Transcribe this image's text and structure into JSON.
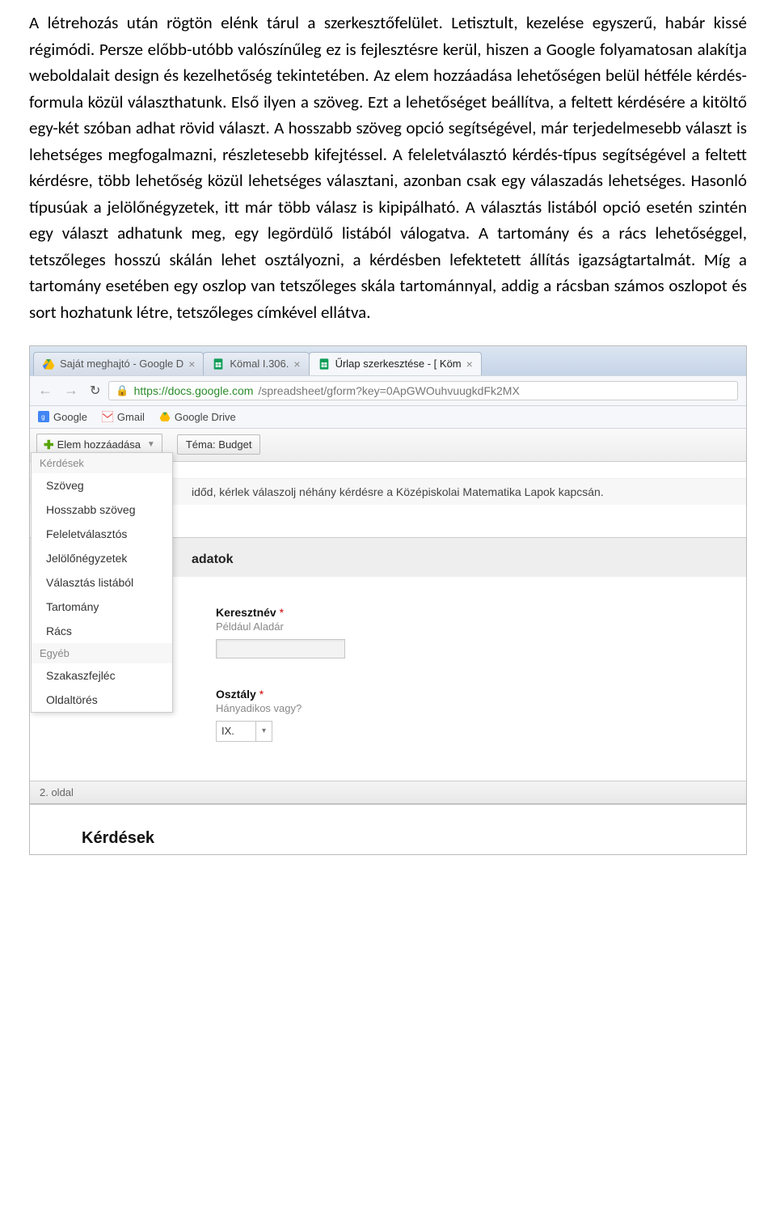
{
  "doc": {
    "paragraph": "A létrehozás után rögtön elénk tárul a szerkesztőfelület. Letisztult, kezelése egyszerű, habár kissé régimódi. Persze előbb-utóbb valószínűleg ez is fejlesztésre kerül, hiszen a Google folyamatosan alakítja weboldalait design és kezelhetőség tekintetében. Az elem hozzáadása lehetőségen belül hétféle kérdés-formula közül választhatunk. Első ilyen a szöveg. Ezt a lehetőséget beállítva, a feltett kérdésére a kitöltő egy-két szóban adhat rövid választ. A hosszabb szöveg opció segítségével, már terjedelmesebb választ is lehetséges megfogalmazni, részletesebb kifejtéssel. A feleletválasztó kérdés-típus segítségével a feltett kérdésre, több lehetőség közül lehetséges választani, azonban csak egy válaszadás lehetséges. Hasonló típusúak a jelölőnégyzetek, itt már több válasz is kipipálható. A választás listából opció esetén szintén egy választ adhatunk meg, egy legördülő listából válogatva. A tartomány és a rács lehetőséggel, tetszőleges hosszú skálán lehet osztályozni, a kérdésben lefektetett állítás igazságtartalmát. Míg a tartomány esetében egy oszlop van tetszőleges skála tartománnyal, addig a rácsban számos oszlopot és sort hozhatunk létre, tetszőleges címkével ellátva."
  },
  "browser": {
    "tabs": [
      {
        "label": "Saját meghajtó - Google D"
      },
      {
        "label": "Kömal I.306."
      },
      {
        "label": "Űrlap szerkesztése - [ Köm"
      }
    ],
    "url_host": "https://docs.google.com",
    "url_path": "/spreadsheet/gform?key=0ApGWOuhvuugkdFk2MX",
    "bookmarks": [
      {
        "label": "Google"
      },
      {
        "label": "Gmail"
      },
      {
        "label": "Google Drive"
      }
    ]
  },
  "toolbar": {
    "add_label": "Elem hozzáadása",
    "theme_label": "Téma: Budget"
  },
  "menu": {
    "header1": "Kérdések",
    "items1": [
      "Szöveg",
      "Hosszabb szöveg",
      "Feleletválasztós",
      "Jelölőnégyzetek",
      "Választás listából",
      "Tartomány",
      "Rács"
    ],
    "header2": "Egyéb",
    "items2": [
      "Szakaszfejléc",
      "Oldaltörés"
    ]
  },
  "form": {
    "desc_fragment": "időd, kérlek válaszolj néhány kérdésre a Középiskolai Matematika Lapok kapcsán.",
    "section_title_fragment": "adatok",
    "q1": {
      "title": "Keresztnév",
      "help": "Például Aladár"
    },
    "q2": {
      "title": "Osztály",
      "help": "Hányadikos vagy?",
      "value": "IX."
    },
    "page_marker": "2. oldal",
    "page2_header": "Kérdések"
  }
}
